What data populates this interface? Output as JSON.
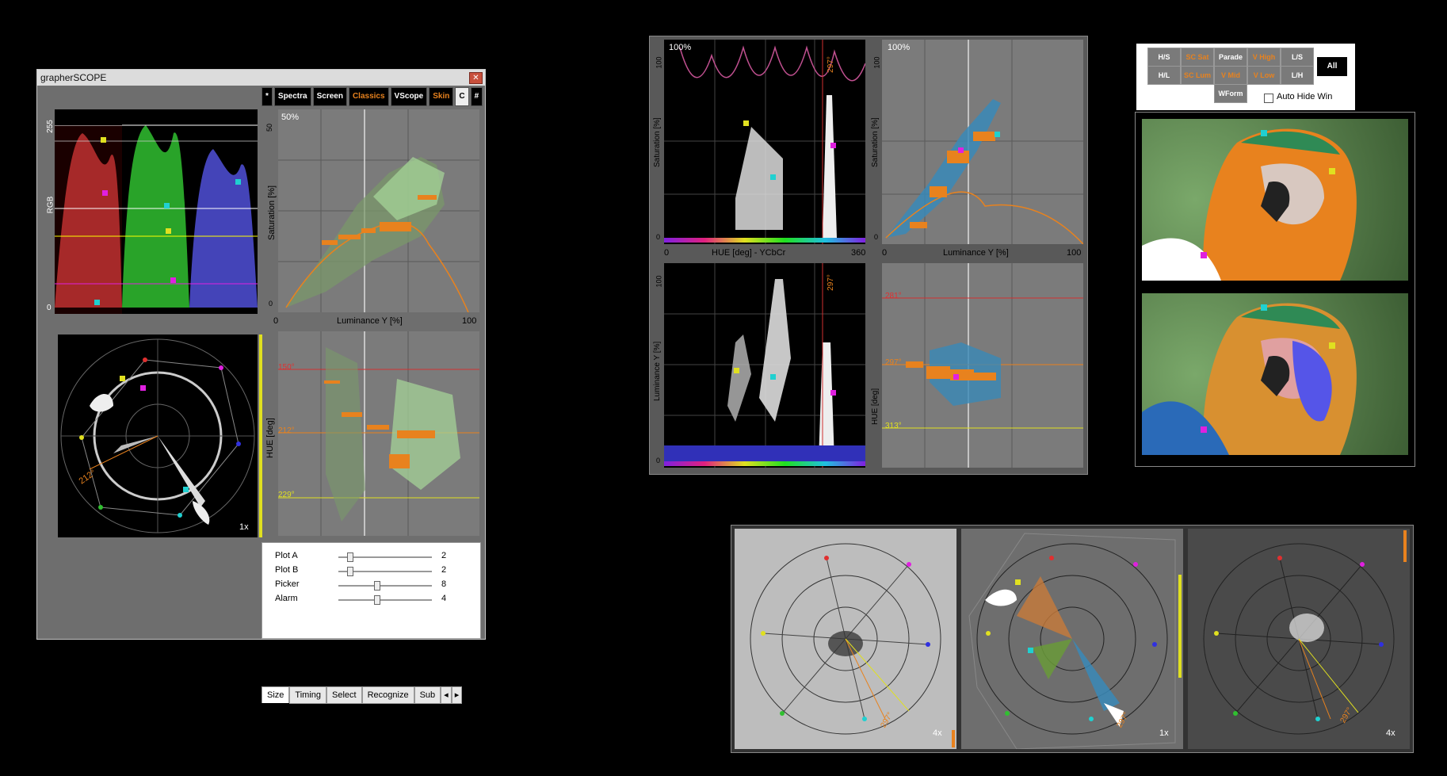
{
  "window": {
    "title": "grapherSCOPE",
    "close_glyph": "✕",
    "tabs": [
      {
        "label": "*",
        "accent": "none"
      },
      {
        "label": "Spectra",
        "accent": "none"
      },
      {
        "label": "Screen",
        "accent": "none"
      },
      {
        "label": "Classics",
        "accent": "orange"
      },
      {
        "label": "VScope",
        "accent": "none"
      },
      {
        "label": "Skin",
        "accent": "orange"
      },
      {
        "label": "C",
        "accent": "white"
      },
      {
        "label": "#",
        "accent": "none"
      }
    ],
    "rgb_parade": {
      "y_label": "RGB",
      "tick_top": "255",
      "tick_bottom": "0"
    },
    "vectorscope": {
      "angle_label": "212°",
      "zoom": "1x"
    },
    "sat_lum_plot": {
      "percent": "50%",
      "y_label": "Saturation [%]",
      "y_tick_top": "50",
      "y_tick_bottom": "0",
      "x_label": "Luminance Y [%]",
      "x_tick_left": "0",
      "x_tick_right": "100"
    },
    "hue_lum_plot": {
      "y_label": "HUE [deg]",
      "lines": [
        "150°",
        "212°",
        "229°"
      ]
    },
    "settings": {
      "rows": [
        {
          "label": "Plot A",
          "value": "2",
          "level": 0.1
        },
        {
          "label": "Plot B",
          "value": "2",
          "level": 0.1
        },
        {
          "label": "Picker",
          "value": "8",
          "level": 0.4
        },
        {
          "label": "Alarm",
          "value": "4",
          "level": 0.4
        }
      ]
    },
    "bottom_tabs": [
      "Size",
      "Timing",
      "Select",
      "Recognize",
      "Sub"
    ],
    "scroll_left": "◂",
    "scroll_right": "▸"
  },
  "middle_panel": {
    "hue_sat": {
      "percent": "100%",
      "y_label": "Saturation [%]",
      "y_tick_top": "100",
      "y_tick_bottom": "0",
      "x_label": "HUE [deg] - YCbCr",
      "x_tick_left": "0",
      "x_tick_right": "360",
      "marker": "297°"
    },
    "lum_sat": {
      "percent": "100%",
      "y_label": "Saturation [%]",
      "y_tick_top": "100",
      "y_tick_bottom": "0",
      "x_label": "Luminance Y [%]",
      "x_tick_left": "0",
      "x_tick_right": "100"
    },
    "hue_lum": {
      "y_label": "Luminance Y [%]",
      "y_tick_top": "100",
      "y_tick_bottom": "0",
      "marker": "297°"
    },
    "lum_hue": {
      "y_label": "HUE [deg]",
      "lines": [
        "281°",
        "297°",
        "313°"
      ]
    }
  },
  "toolbar": {
    "buttons": [
      {
        "label": "H/S",
        "accent": "none"
      },
      {
        "label": "SC Sat",
        "accent": "orange"
      },
      {
        "label": "Parade",
        "accent": "none"
      },
      {
        "label": "V High",
        "accent": "orange"
      },
      {
        "label": "L/S",
        "accent": "none"
      },
      {
        "label": "H/L",
        "accent": "none"
      },
      {
        "label": "SC Lum",
        "accent": "orange"
      },
      {
        "label": "V Mid",
        "accent": "orange"
      },
      {
        "label": "V Low",
        "accent": "orange"
      },
      {
        "label": "L/H",
        "accent": "none"
      },
      {
        "label": "WForm",
        "accent": "none"
      }
    ],
    "all_label": "All",
    "auto_hide_label": "Auto Hide Win",
    "auto_hide_checked": false
  },
  "bottom_scopes": [
    {
      "zoom": "4x",
      "angle_label": "297°"
    },
    {
      "zoom": "1x",
      "angle_label": "297°"
    },
    {
      "zoom": "4x",
      "angle_label": "297°"
    }
  ],
  "colors": {
    "accent_orange": "#e8821e",
    "red": "#e03030",
    "green": "#30c030",
    "blue": "#5050e0",
    "yellow": "#e0e020",
    "magenta": "#e020e0",
    "cyan": "#20d0d0"
  }
}
